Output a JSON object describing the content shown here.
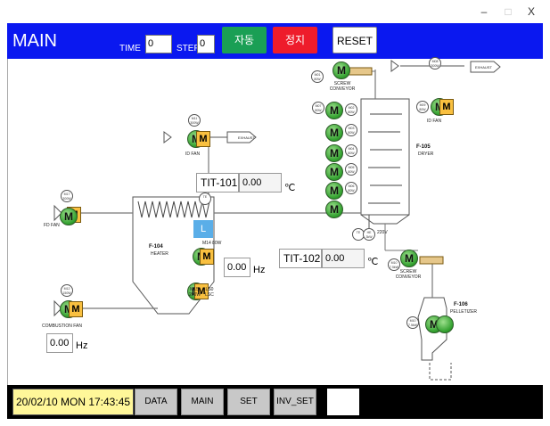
{
  "window": {
    "controls": {
      "minimize": "–",
      "maximize": "□",
      "close": "X"
    }
  },
  "header": {
    "title": "MAIN",
    "time_label": "TIME",
    "time_value": "0",
    "step_label": "STEP",
    "step_value": "0",
    "auto_button": "자동",
    "stop_button": "정지",
    "reset_button": "RESET"
  },
  "process": {
    "exhaust_1": "EXHAUST",
    "exhaust_2": "EXHAUST",
    "id_fan_1": "ID FAN",
    "id_fan_2": "ID FAN",
    "fd_fan": "FD FAN",
    "combustion_fan": "COMBUSTION FAN",
    "screw_conveyor_top": "SCREW CONVEYOR",
    "screw_conveyor_bottom": "SCREW CONVEYOR",
    "heater_tag": "F-104",
    "heater_name": "HEATER",
    "dryer_tag": "F-105",
    "dryer_name": "DRYER",
    "pelletizer_tag": "F-106",
    "pelletizer_name": "PELLETIZER",
    "motor_letter": "M",
    "level_letter": "L",
    "m14_tag": "M14 80W",
    "m15_tag": "M15 200W",
    "lsc_label": "LS0 LSC",
    "volt_220": "220V",
    "tags": {
      "m17": "M17 300W",
      "m11": "M11 300W",
      "m12": "M12 150W",
      "m01": "M01 80W",
      "m02": "M02 80W",
      "m03": "M03 80W",
      "m04": "M04 80W",
      "m05": "M05 80W",
      "m06": "M06 80W",
      "m07": "M07 80W",
      "m08": "M08 300W",
      "m09": "M09 80W",
      "m10": "M10 7.5kW",
      "te1": "TE",
      "te2": "TE",
      "he": "HE 3kW"
    },
    "tit101": {
      "label": "TIT-101",
      "value": "0.00",
      "unit": "℃"
    },
    "tit102": {
      "label": "TIT-102",
      "value": "0.00",
      "unit": "℃"
    },
    "fan_freq": {
      "value": "0.00",
      "unit": "Hz"
    },
    "combustion_freq": {
      "value": "0.00",
      "unit": "Hz"
    }
  },
  "footer": {
    "clock": "20/02/10 MON 17:43:45",
    "nav": [
      "DATA",
      "MAIN",
      "SET",
      "INV_SET"
    ]
  },
  "colors": {
    "header_bg": "#0a18f0",
    "auto_btn": "#1a9f55",
    "stop_btn": "#ee1c2b",
    "level_box": "#5aaee8",
    "motor_green": "#2f9e2c",
    "clock_bg": "#fff799"
  }
}
